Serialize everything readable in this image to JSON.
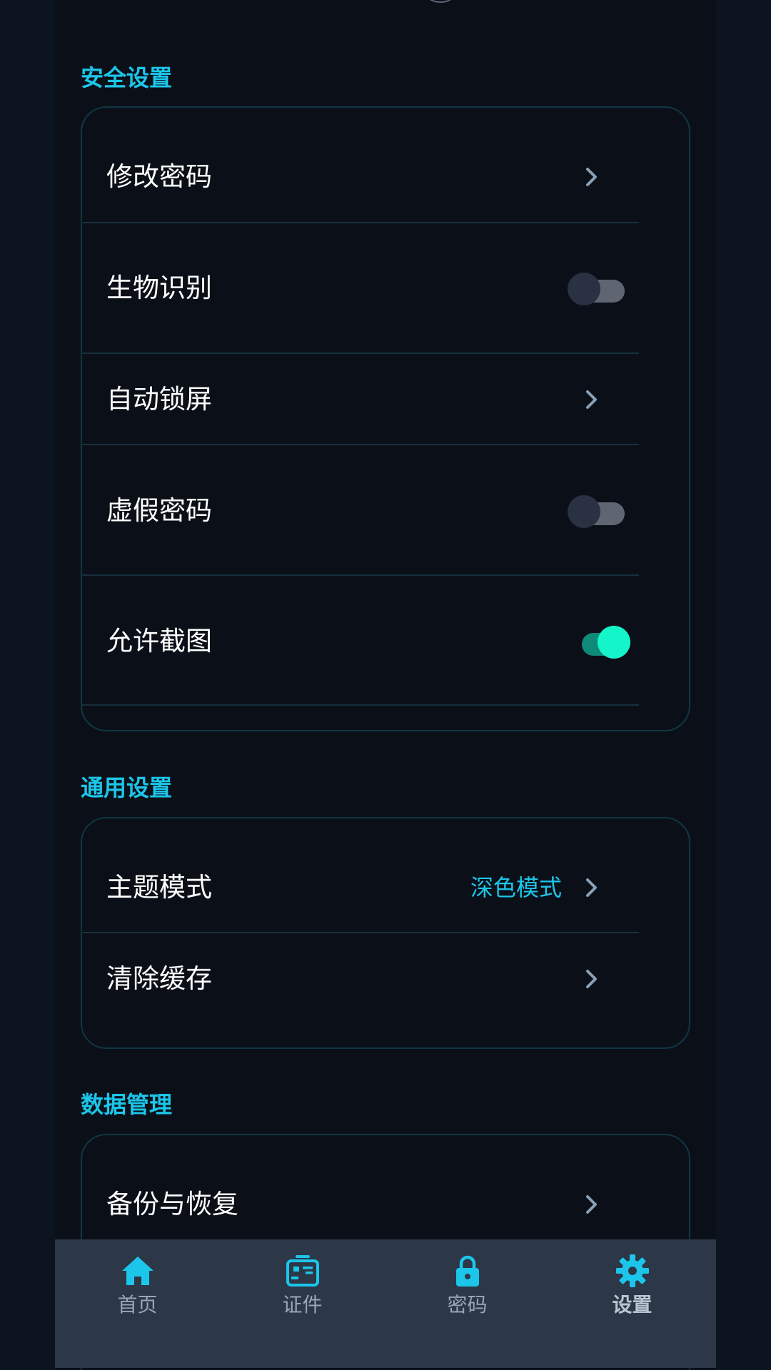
{
  "sections": {
    "security": {
      "title": "安全设置",
      "items": [
        {
          "label": "修改密码",
          "control": "chevron"
        },
        {
          "label": "生物识别",
          "control": "toggle",
          "on": false
        },
        {
          "label": "自动锁屏",
          "control": "chevron"
        },
        {
          "label": "虚假密码",
          "control": "toggle",
          "on": false
        },
        {
          "label": "允许截图",
          "control": "toggle",
          "on": true
        }
      ]
    },
    "general": {
      "title": "通用设置",
      "items": [
        {
          "label": "主题模式",
          "value": "深色模式",
          "control": "chevron"
        },
        {
          "label": "清除缓存",
          "control": "chevron"
        }
      ]
    },
    "data": {
      "title": "数据管理",
      "items": [
        {
          "label": "备份与恢复",
          "control": "chevron"
        }
      ]
    }
  },
  "tabbar": {
    "items": [
      {
        "label": "首页",
        "icon": "home-icon"
      },
      {
        "label": "证件",
        "icon": "id-card-icon"
      },
      {
        "label": "密码",
        "icon": "lock-icon"
      },
      {
        "label": "设置",
        "icon": "gear-icon",
        "active": true
      }
    ]
  },
  "colors": {
    "accent": "#1cc6ea",
    "toggle_on": "#14f5c9",
    "background": "#0b1018",
    "tabbar": "#2c3748"
  }
}
